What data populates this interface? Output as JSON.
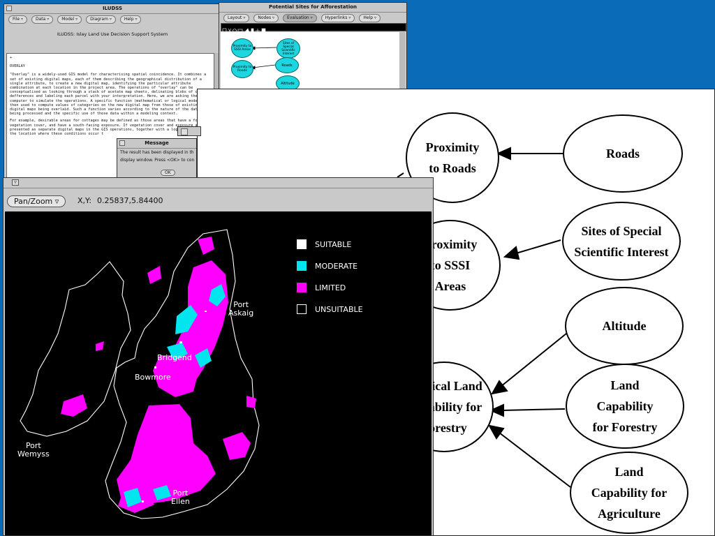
{
  "iludss": {
    "title": "ILUDSS",
    "menus": [
      "File",
      "Data",
      "Model",
      "Diagram",
      "Help"
    ],
    "subtitle": "ILUDSS: Islay Land Use Decision Support System",
    "text_marker": "+",
    "heading": "OVERLAY",
    "paragraph1": "\"Overlay\" is a widely-used GIS model for characterising spatial coincidence. It combines a set of existing digital maps, each of them describing the geographical distribution of a single attribute, to create a new digital map, identifying the particular attribute combination at each location in the project area. The operations of \"overlay\" can be conceptualised as looking through a stack of acetate map sheets, delinating blobs of color defferences and labeling each parcel with your interpretation. Here, we are asking the computer to simulate the operations. A specific function (mathematical or logical model) is then used to compute values of categories on the new digital map from those of existing digital maps being overlaid. Such a function varies according to the nature of the data being processed and the specific use of those data within a modeling context.",
    "paragraph2": "For example, desirable areas for cottages may be defined as those areas that have a forest vegetation cover, and have a south-facing exposure. If vegetation cover and exposure are presented as separate digital maps in the GIS operations, together with a logical operation, the location where these conditions occur t"
  },
  "message": {
    "title": "Message",
    "line1": "The result has been displayed in th",
    "line2": "display window. Press <OK> to con",
    "ok_label": "OK"
  },
  "afforestation": {
    "title": "Potential Sites for Afforestation",
    "menus": [
      "Layout",
      "Nodes",
      "Evaluation",
      "Hyperlinks",
      "Help"
    ],
    "active_menu": "Evaluation",
    "mini_nodes": {
      "proximity_sssi": "Proximity to SSSI Areas",
      "special_sites": "Sites of Special Scientific Interest",
      "proximity_roads": "Proximity to Roads",
      "roads": "Roads",
      "altitude": "Altitude"
    }
  },
  "diagram": {
    "proximity_roads": "Proximity\nto Roads",
    "proximity_sssi": "Proximity\nto SSSI\nAreas",
    "physical_land": "Physical Land\nCapability for\nForestry",
    "roads": "Roads",
    "sites_special": "Sites of Special\nScientific Interest",
    "altitude": "Altitude",
    "land_forestry": "Land\nCapability\nfor Forestry",
    "land_agriculture": "Land\nCapability for\nAgriculture"
  },
  "map": {
    "mode": "Pan/Zoom",
    "xy_label": "X,Y:",
    "xy_value": "0.25837,5.84400",
    "legend": [
      {
        "label": "SUITABLE",
        "color": "#ffffff"
      },
      {
        "label": "MODERATE",
        "color": "#00e5ee"
      },
      {
        "label": "LIMITED",
        "color": "#ff00ff"
      },
      {
        "label": "UNSUITABLE",
        "color": "#000000"
      }
    ],
    "towns": {
      "port_askaig": "Port\nAskaig",
      "bridgend": "Bridgend",
      "bowmore": "Bowmore",
      "port_wemyss": "Port\nWemyss",
      "port_ellen": "Port\nEllen"
    }
  }
}
